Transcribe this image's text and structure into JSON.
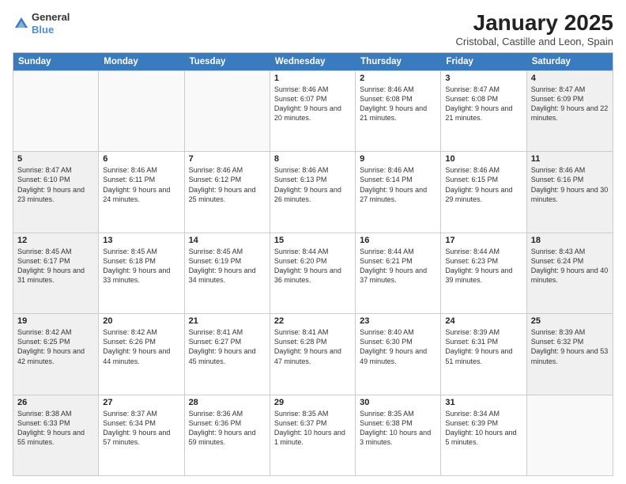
{
  "header": {
    "logo_general": "General",
    "logo_blue": "Blue",
    "month_title": "January 2025",
    "location": "Cristobal, Castille and Leon, Spain"
  },
  "calendar": {
    "days_of_week": [
      "Sunday",
      "Monday",
      "Tuesday",
      "Wednesday",
      "Thursday",
      "Friday",
      "Saturday"
    ],
    "rows": [
      [
        {
          "day": "",
          "text": "",
          "empty": true
        },
        {
          "day": "",
          "text": "",
          "empty": true
        },
        {
          "day": "",
          "text": "",
          "empty": true
        },
        {
          "day": "1",
          "text": "Sunrise: 8:46 AM\nSunset: 6:07 PM\nDaylight: 9 hours and 20 minutes.",
          "empty": false
        },
        {
          "day": "2",
          "text": "Sunrise: 8:46 AM\nSunset: 6:08 PM\nDaylight: 9 hours and 21 minutes.",
          "empty": false
        },
        {
          "day": "3",
          "text": "Sunrise: 8:47 AM\nSunset: 6:08 PM\nDaylight: 9 hours and 21 minutes.",
          "empty": false
        },
        {
          "day": "4",
          "text": "Sunrise: 8:47 AM\nSunset: 6:09 PM\nDaylight: 9 hours and 22 minutes.",
          "empty": false,
          "shaded": true
        }
      ],
      [
        {
          "day": "5",
          "text": "Sunrise: 8:47 AM\nSunset: 6:10 PM\nDaylight: 9 hours and 23 minutes.",
          "empty": false,
          "shaded": true
        },
        {
          "day": "6",
          "text": "Sunrise: 8:46 AM\nSunset: 6:11 PM\nDaylight: 9 hours and 24 minutes.",
          "empty": false
        },
        {
          "day": "7",
          "text": "Sunrise: 8:46 AM\nSunset: 6:12 PM\nDaylight: 9 hours and 25 minutes.",
          "empty": false
        },
        {
          "day": "8",
          "text": "Sunrise: 8:46 AM\nSunset: 6:13 PM\nDaylight: 9 hours and 26 minutes.",
          "empty": false
        },
        {
          "day": "9",
          "text": "Sunrise: 8:46 AM\nSunset: 6:14 PM\nDaylight: 9 hours and 27 minutes.",
          "empty": false
        },
        {
          "day": "10",
          "text": "Sunrise: 8:46 AM\nSunset: 6:15 PM\nDaylight: 9 hours and 29 minutes.",
          "empty": false
        },
        {
          "day": "11",
          "text": "Sunrise: 8:46 AM\nSunset: 6:16 PM\nDaylight: 9 hours and 30 minutes.",
          "empty": false,
          "shaded": true
        }
      ],
      [
        {
          "day": "12",
          "text": "Sunrise: 8:45 AM\nSunset: 6:17 PM\nDaylight: 9 hours and 31 minutes.",
          "empty": false,
          "shaded": true
        },
        {
          "day": "13",
          "text": "Sunrise: 8:45 AM\nSunset: 6:18 PM\nDaylight: 9 hours and 33 minutes.",
          "empty": false
        },
        {
          "day": "14",
          "text": "Sunrise: 8:45 AM\nSunset: 6:19 PM\nDaylight: 9 hours and 34 minutes.",
          "empty": false
        },
        {
          "day": "15",
          "text": "Sunrise: 8:44 AM\nSunset: 6:20 PM\nDaylight: 9 hours and 36 minutes.",
          "empty": false
        },
        {
          "day": "16",
          "text": "Sunrise: 8:44 AM\nSunset: 6:21 PM\nDaylight: 9 hours and 37 minutes.",
          "empty": false
        },
        {
          "day": "17",
          "text": "Sunrise: 8:44 AM\nSunset: 6:23 PM\nDaylight: 9 hours and 39 minutes.",
          "empty": false
        },
        {
          "day": "18",
          "text": "Sunrise: 8:43 AM\nSunset: 6:24 PM\nDaylight: 9 hours and 40 minutes.",
          "empty": false,
          "shaded": true
        }
      ],
      [
        {
          "day": "19",
          "text": "Sunrise: 8:42 AM\nSunset: 6:25 PM\nDaylight: 9 hours and 42 minutes.",
          "empty": false,
          "shaded": true
        },
        {
          "day": "20",
          "text": "Sunrise: 8:42 AM\nSunset: 6:26 PM\nDaylight: 9 hours and 44 minutes.",
          "empty": false
        },
        {
          "day": "21",
          "text": "Sunrise: 8:41 AM\nSunset: 6:27 PM\nDaylight: 9 hours and 45 minutes.",
          "empty": false
        },
        {
          "day": "22",
          "text": "Sunrise: 8:41 AM\nSunset: 6:28 PM\nDaylight: 9 hours and 47 minutes.",
          "empty": false
        },
        {
          "day": "23",
          "text": "Sunrise: 8:40 AM\nSunset: 6:30 PM\nDaylight: 9 hours and 49 minutes.",
          "empty": false
        },
        {
          "day": "24",
          "text": "Sunrise: 8:39 AM\nSunset: 6:31 PM\nDaylight: 9 hours and 51 minutes.",
          "empty": false
        },
        {
          "day": "25",
          "text": "Sunrise: 8:39 AM\nSunset: 6:32 PM\nDaylight: 9 hours and 53 minutes.",
          "empty": false,
          "shaded": true
        }
      ],
      [
        {
          "day": "26",
          "text": "Sunrise: 8:38 AM\nSunset: 6:33 PM\nDaylight: 9 hours and 55 minutes.",
          "empty": false,
          "shaded": true
        },
        {
          "day": "27",
          "text": "Sunrise: 8:37 AM\nSunset: 6:34 PM\nDaylight: 9 hours and 57 minutes.",
          "empty": false
        },
        {
          "day": "28",
          "text": "Sunrise: 8:36 AM\nSunset: 6:36 PM\nDaylight: 9 hours and 59 minutes.",
          "empty": false
        },
        {
          "day": "29",
          "text": "Sunrise: 8:35 AM\nSunset: 6:37 PM\nDaylight: 10 hours and 1 minute.",
          "empty": false
        },
        {
          "day": "30",
          "text": "Sunrise: 8:35 AM\nSunset: 6:38 PM\nDaylight: 10 hours and 3 minutes.",
          "empty": false
        },
        {
          "day": "31",
          "text": "Sunrise: 8:34 AM\nSunset: 6:39 PM\nDaylight: 10 hours and 5 minutes.",
          "empty": false
        },
        {
          "day": "",
          "text": "",
          "empty": true,
          "shaded": true
        }
      ]
    ]
  }
}
